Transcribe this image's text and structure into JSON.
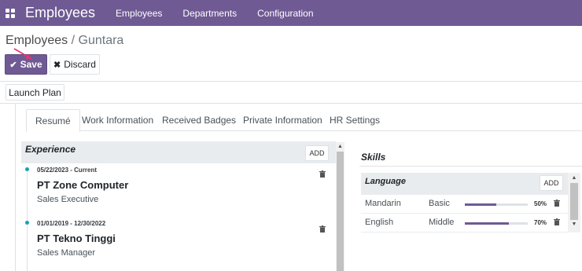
{
  "navbar": {
    "app_title": "Employees",
    "menu": [
      "Employees",
      "Departments",
      "Configuration"
    ],
    "background_color": "#6f5a94"
  },
  "breadcrumb": {
    "parent": "Employees",
    "separator": " / ",
    "current": "Guntara"
  },
  "actions": {
    "save_label": "Save",
    "discard_label": "Discard",
    "launch_plan_label": "Launch Plan"
  },
  "tabs": [
    {
      "label": "Resumé",
      "active": true
    },
    {
      "label": "Work Information",
      "active": false
    },
    {
      "label": "Received Badges",
      "active": false
    },
    {
      "label": "Private Information",
      "active": false
    },
    {
      "label": "HR Settings",
      "active": false
    }
  ],
  "experience": {
    "title": "Experience",
    "add_label": "ADD",
    "items": [
      {
        "dates": "05/22/2023 - Current",
        "company": "PT Zone Computer",
        "role": "Sales Executive"
      },
      {
        "dates": "01/01/2019 - 12/30/2022",
        "company": "PT Tekno Tinggi",
        "role": "Sales Manager"
      }
    ]
  },
  "skills": {
    "title": "Skills",
    "groups": [
      {
        "title": "Language",
        "add_label": "ADD",
        "rows": [
          {
            "name": "Mandarin",
            "level": "Basic",
            "progress_label": "50%",
            "progress": 50
          },
          {
            "name": "English",
            "level": "Middle",
            "progress_label": "70%",
            "progress": 70
          }
        ]
      }
    ]
  },
  "colors": {
    "accent": "#6f5a94",
    "timeline_dot": "#17a2b8"
  }
}
